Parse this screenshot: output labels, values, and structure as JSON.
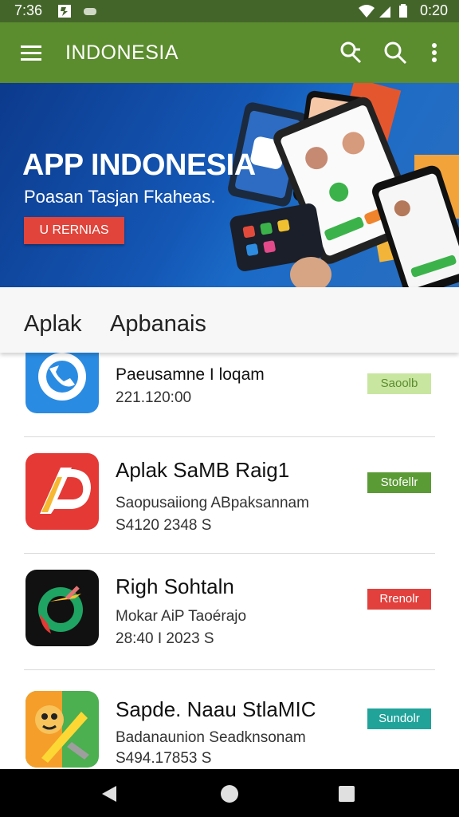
{
  "status_bar": {
    "time": "7:36",
    "right_time": "0:20"
  },
  "app_bar": {
    "title": "INDONESIA"
  },
  "banner": {
    "headline": "APP INDONESIA",
    "subtitle": "Poasan Tasjan Fkaheas.",
    "cta_label": "U RERNIAS",
    "colors": {
      "background": "#1457b5",
      "cta": "#e0443a"
    }
  },
  "tabs": [
    "Aplak",
    "Apbanais"
  ],
  "apps": [
    {
      "name": "Paeusamne I loqam",
      "description": "",
      "meta": "221.120:00",
      "badge": "Saoolb",
      "badge_color": "#c8e6a0",
      "badge_text_color": "#5b8c2e",
      "icon": "phone-app-icon",
      "partial": true
    },
    {
      "name": "Aplak SaMB Raig1",
      "description": "Saopusaiiong ABpaksannam",
      "meta": "S4120 2348 S",
      "badge": "Stofellr",
      "badge_color": "#5b9b35",
      "icon": "red-a-app-icon"
    },
    {
      "name": "Righ Sohtaln",
      "description": "Mokar AiP Taoérajo",
      "meta": "28:40 I 2023 S",
      "badge": "Rrenolr",
      "badge_color": "#e2403c",
      "icon": "globe-chat-app-icon"
    },
    {
      "name": "Sapde. Naau StlaMIC",
      "description": "Badanaunion Seadknsonam",
      "meta": "S494.17853 S",
      "badge": "Sundolr",
      "badge_color": "#21a39a",
      "icon": "pencil-tools-app-icon"
    }
  ],
  "colors": {
    "app_bar": "#5b8c2e",
    "status_bar": "#44652a"
  }
}
